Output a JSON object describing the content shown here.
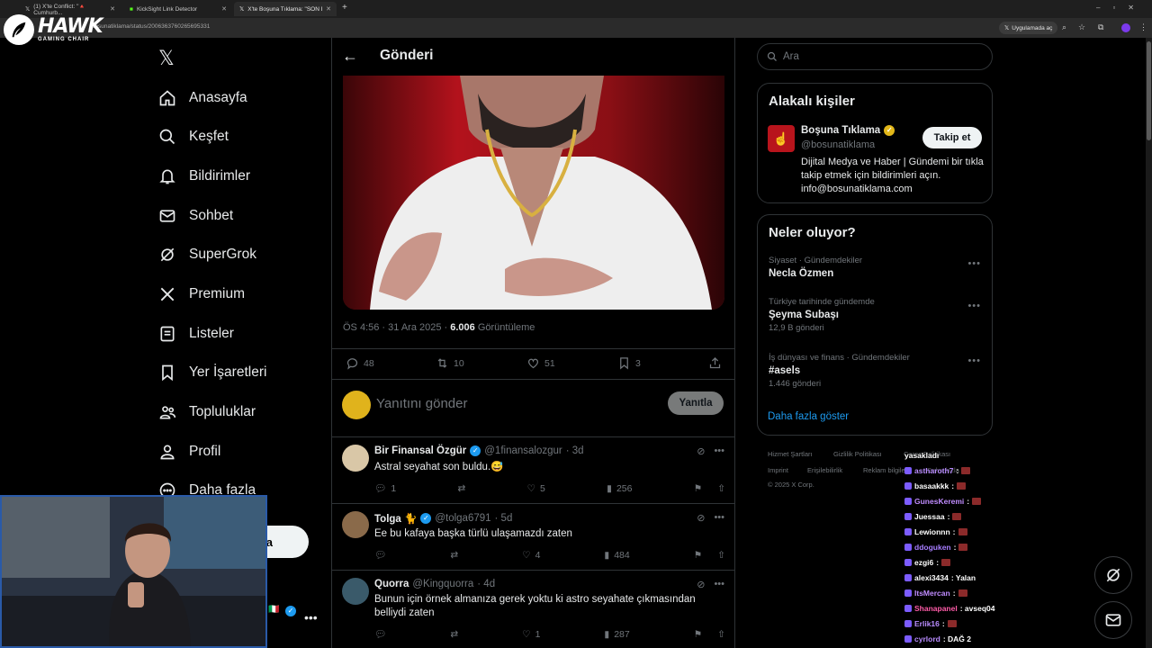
{
  "browser": {
    "tabs": [
      {
        "title": "(1) X'te Conflict: \"🔺 Cumhurb...",
        "active": false
      },
      {
        "title": "KickSight Link Detector",
        "active": false
      },
      {
        "title": "X'te Boşuna Tıklama: \"SON DA...",
        "active": true
      }
    ],
    "url": "/bosunatiklama/status/2006363760265695331",
    "open_in_app": "Uygulamada aç",
    "new_tab": "+"
  },
  "overlay_logo": {
    "brand": "HAWK",
    "sub": "GAMING CHAIR"
  },
  "nav": {
    "items": [
      {
        "label": "Anasayfa",
        "icon": "home-icon"
      },
      {
        "label": "Keşfet",
        "icon": "search-icon"
      },
      {
        "label": "Bildirimler",
        "icon": "bell-icon"
      },
      {
        "label": "Sohbet",
        "icon": "mail-icon"
      },
      {
        "label": "SuperGrok",
        "icon": "grok-icon"
      },
      {
        "label": "Premium",
        "icon": "x-icon"
      },
      {
        "label": "Listeler",
        "icon": "list-icon"
      },
      {
        "label": "Yer İşaretleri",
        "icon": "bookmark-icon"
      },
      {
        "label": "Topluluklar",
        "icon": "community-icon"
      },
      {
        "label": "Profil",
        "icon": "profile-icon"
      },
      {
        "label": "Daha fazla",
        "icon": "more-icon"
      }
    ],
    "post_button": "a"
  },
  "post": {
    "header_title": "Gönderi",
    "meta_time": "ÖS 4:56 · 31 Ara 2025 · ",
    "views": "6.006",
    "views_label": " Görüntüleme",
    "replies": "48",
    "reposts": "10",
    "likes": "51",
    "bookmarks": "3"
  },
  "reply_box": {
    "placeholder": "Yanıtını gönder",
    "button": "Yanıtla"
  },
  "replies": [
    {
      "name": "Bir Finansal Özgür",
      "handle": "@1finansalozgur",
      "time": "· 3d",
      "text": "Astral seyahat son buldu.😅",
      "replies": "1",
      "reposts": "",
      "likes": "5",
      "views": "256"
    },
    {
      "name": "Tolga 🐈",
      "handle": "@tolga6791",
      "time": "· 5d",
      "text": "Ee bu kafaya başka türlü ulaşamazdı zaten",
      "replies": "",
      "reposts": "",
      "likes": "4",
      "views": "484"
    },
    {
      "name": "Quorra",
      "handle": "@Kingquorra",
      "time": "· 4d",
      "text": "Bunun için örnek almanıza gerek yoktu ki astro seyahate çıkmasından belliydi zaten",
      "replies": "",
      "reposts": "",
      "likes": "1",
      "views": "287"
    }
  ],
  "search": {
    "placeholder": "Ara"
  },
  "relevant": {
    "title": "Alakalı kişiler",
    "name": "Boşuna Tıklama",
    "handle": "@bosunatiklama",
    "follow": "Takip et",
    "bio": "Dijital Medya ve Haber | Gündemi bir tıkla takip etmek için bildirimleri açın. info@bosunatiklama.com"
  },
  "trends": {
    "title": "Neler oluyor?",
    "items": [
      {
        "category": "Siyaset · Gündemdekiler",
        "name": "Necla Özmen",
        "count": ""
      },
      {
        "category": "Türkiye tarihinde gündemde",
        "name": "Şeyma Subaşı",
        "count": "12,9 B gönderi"
      },
      {
        "category": "İş dünyası ve finans · Gündemdekiler",
        "name": "#asels",
        "count": "1.446 gönderi"
      }
    ],
    "show_more": "Daha fazla göster"
  },
  "footer": {
    "links": [
      "Hizmet Şartları",
      "Gizlilik Politikası",
      "Çerez Politikası",
      "Imprint",
      "Erişilebilirlik",
      "Reklam bilgileri",
      "Daha fazla ..."
    ],
    "copyright": "© 2025 X Corp."
  },
  "chat": [
    {
      "user": "yasakladı",
      "msg": "",
      "color": "#ffffff"
    },
    {
      "user": "astharoth7",
      "msg": ":",
      "color": "#b98cff"
    },
    {
      "user": "basaakkk",
      "msg": ":",
      "color": "#ffffff"
    },
    {
      "user": "GunesKeremi",
      "msg": ":",
      "color": "#c08cff"
    },
    {
      "user": "Juessaa",
      "msg": ":",
      "color": "#ffffff"
    },
    {
      "user": "Lewionnn",
      "msg": ":",
      "color": "#ffffff"
    },
    {
      "user": "ddoguken",
      "msg": ":",
      "color": "#a77dff"
    },
    {
      "user": "ezgi6",
      "msg": ":",
      "color": "#ffffff"
    },
    {
      "user": "alexi3434",
      "msg": ": Yalan",
      "color": "#ffffff"
    },
    {
      "user": "ItsMercan",
      "msg": ":",
      "color": "#c08cff"
    },
    {
      "user": "Shanapanel",
      "msg": ": avseq04",
      "color": "#ff5ca8"
    },
    {
      "user": "Erlik16",
      "msg": ":",
      "color": "#b98cff"
    },
    {
      "user": "cyrlord",
      "msg": ": DAĞ 2",
      "color": "#b98cff"
    }
  ],
  "colors": {
    "accent": "#1d9bf0",
    "border": "#2f3336",
    "muted": "#71767b",
    "text": "#e7e9ea"
  }
}
